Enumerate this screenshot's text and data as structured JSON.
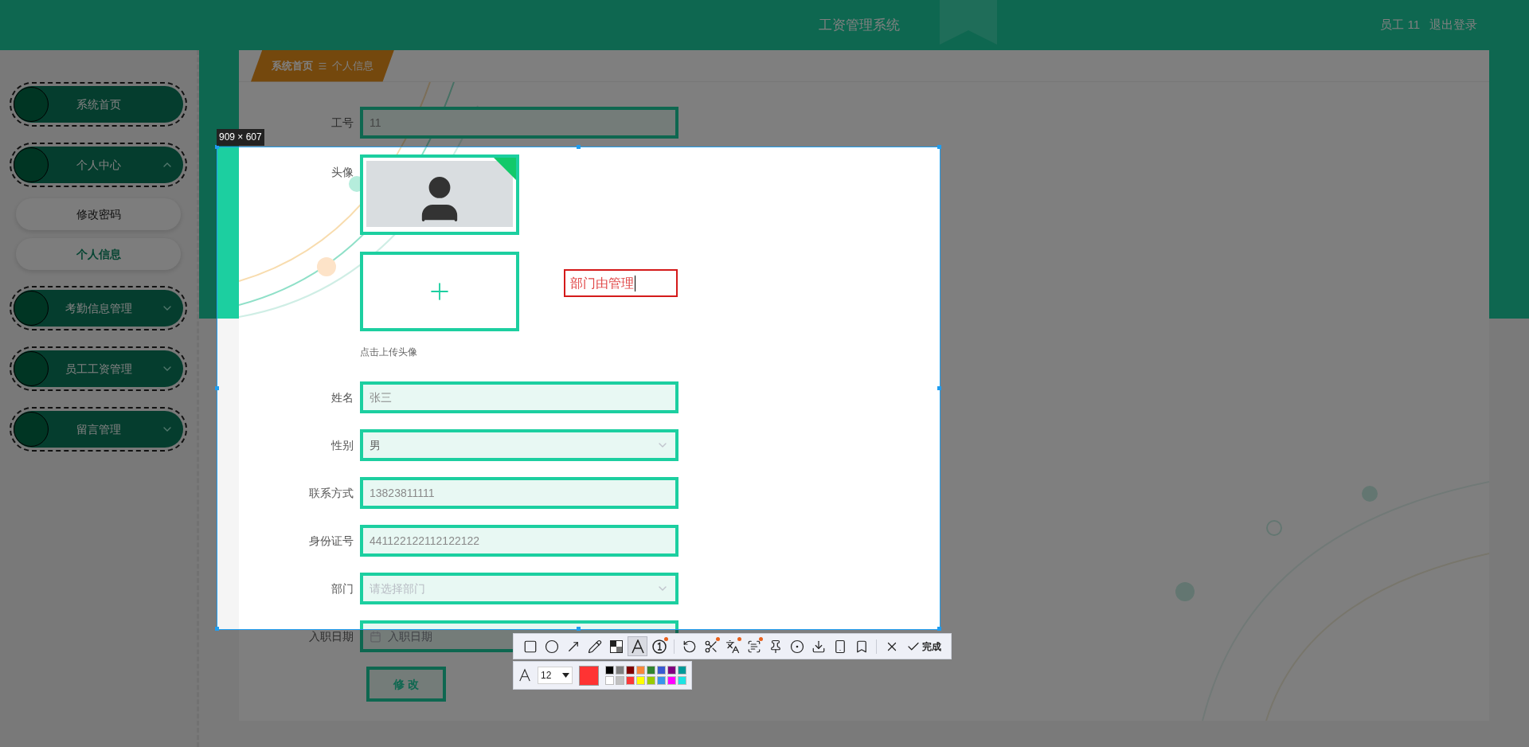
{
  "header": {
    "title": "工资管理系统",
    "user": "员工 11",
    "logout": "退出登录"
  },
  "sidebar": {
    "items": [
      {
        "label": "系统首页",
        "kind": "link"
      },
      {
        "label": "个人中心",
        "kind": "group",
        "expanded": true,
        "children": [
          {
            "label": "修改密码",
            "selected": false
          },
          {
            "label": "个人信息",
            "selected": true
          }
        ]
      },
      {
        "label": "考勤信息管理",
        "kind": "group",
        "expanded": false
      },
      {
        "label": "员工工资管理",
        "kind": "group",
        "expanded": false
      },
      {
        "label": "留言管理",
        "kind": "group",
        "expanded": false
      }
    ]
  },
  "breadcrumb": [
    {
      "label": "系统首页"
    },
    {
      "label": "个人信息"
    }
  ],
  "form": {
    "fields": [
      {
        "label": "工号",
        "kind": "text",
        "value": "11"
      },
      {
        "label": "头像",
        "kind": "avatar",
        "hint": "点击上传头像"
      },
      {
        "label": "姓名",
        "kind": "text",
        "value": "张三"
      },
      {
        "label": "性别",
        "kind": "select",
        "value": "男"
      },
      {
        "label": "联系方式",
        "kind": "text",
        "value": "13823811111"
      },
      {
        "label": "身份证号",
        "kind": "text",
        "value": "441122122112122122"
      },
      {
        "label": "部门",
        "kind": "select",
        "placeholder": "请选择部门"
      },
      {
        "label": "入职日期",
        "kind": "date",
        "placeholder": "入职日期"
      }
    ],
    "submit": "修 改"
  },
  "capture": {
    "size": "909 × 607",
    "annotation": "部门由管理",
    "tool_groups": [
      {
        "tools": [
          {
            "kind": "rectangle",
            "selected": false,
            "badge": false
          },
          {
            "kind": "ellipse",
            "selected": false,
            "badge": false
          },
          {
            "kind": "arrow",
            "selected": false,
            "badge": false
          },
          {
            "kind": "pencil",
            "selected": false,
            "badge": false
          },
          {
            "kind": "mosaic",
            "selected": false,
            "badge": false
          },
          {
            "kind": "text",
            "selected": true,
            "badge": false
          },
          {
            "kind": "number",
            "selected": false,
            "badge": true
          }
        ]
      },
      {
        "tools": [
          {
            "kind": "undo",
            "selected": false,
            "badge": false
          },
          {
            "kind": "cut",
            "selected": false,
            "badge": true
          },
          {
            "kind": "translate",
            "selected": false,
            "badge": true
          },
          {
            "kind": "ocr",
            "selected": false,
            "badge": true
          },
          {
            "kind": "pin",
            "selected": false,
            "badge": false
          },
          {
            "kind": "record",
            "selected": false,
            "badge": false
          },
          {
            "kind": "download",
            "selected": false,
            "badge": false
          },
          {
            "kind": "phone",
            "selected": false,
            "badge": false
          },
          {
            "kind": "bookmark",
            "selected": false,
            "badge": false
          }
        ]
      },
      {
        "tools": [
          {
            "kind": "close",
            "selected": false,
            "badge": false
          }
        ]
      }
    ],
    "done": "完成",
    "font_size": "12",
    "palette": [
      {
        "color": "#000000"
      },
      {
        "color": "#808080"
      },
      {
        "color": "#800000"
      },
      {
        "color": "#f7883a"
      },
      {
        "color": "#308430"
      },
      {
        "color": "#385ad3"
      },
      {
        "color": "#800080"
      },
      {
        "color": "#009999"
      },
      {
        "color": "#ffffff"
      },
      {
        "color": "#c0c0c0"
      },
      {
        "color": "#fb3838"
      },
      {
        "color": "#ffff00"
      },
      {
        "color": "#99cc00"
      },
      {
        "color": "#3895ec"
      },
      {
        "color": "#ff00ff"
      },
      {
        "color": "#1ee3e3"
      }
    ]
  }
}
